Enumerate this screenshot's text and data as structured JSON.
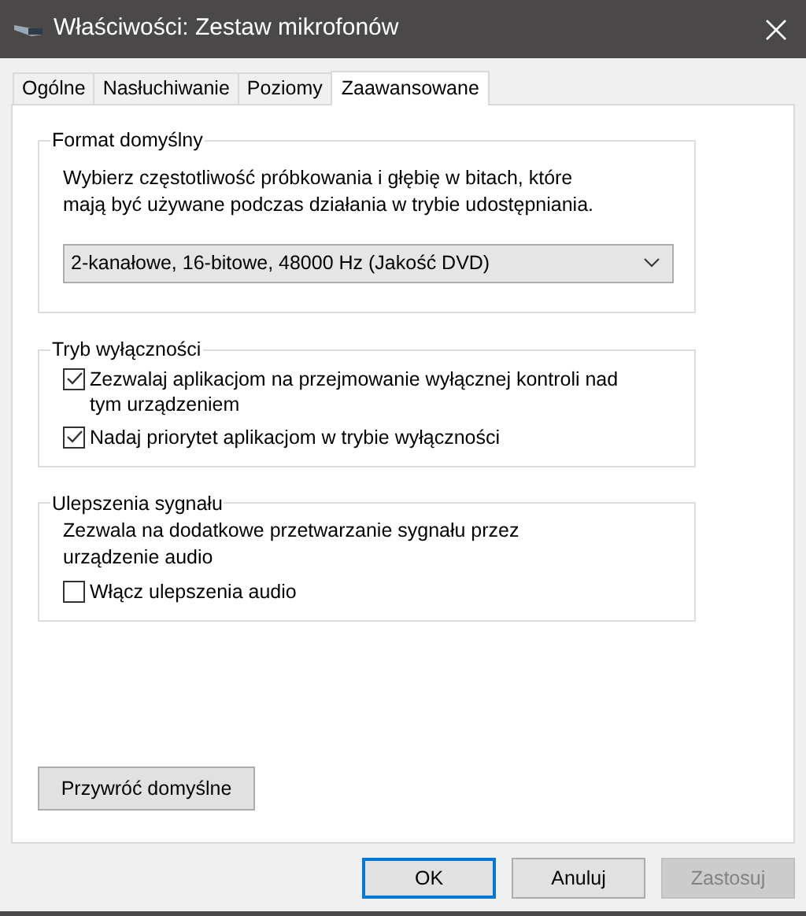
{
  "window": {
    "title": "Właściwości: Zestaw mikrofonów"
  },
  "tabs": [
    {
      "label": "Ogólne",
      "selected": false
    },
    {
      "label": "Nasłuchiwanie",
      "selected": false
    },
    {
      "label": "Poziomy",
      "selected": false
    },
    {
      "label": "Zaawansowane",
      "selected": true
    }
  ],
  "groups": [
    {
      "title": "Format domyślny",
      "items": [
        {
          "kind": "text",
          "text": "Wybierz częstotliwość próbkowania i głębię w bitach, które mają być używane podczas działania w trybie udostępniania."
        },
        {
          "kind": "dropdown",
          "value": "2-kanałowe, 16-bitowe, 48000 Hz (Jakość DVD)"
        }
      ]
    },
    {
      "title": "Tryb wyłączności",
      "items": [
        {
          "kind": "checkbox",
          "label": "Zezwalaj aplikacjom na przejmowanie wyłącznej kontroli nad tym urządzeniem",
          "checked": true
        },
        {
          "kind": "checkbox",
          "label": "Nadaj priorytet aplikacjom w trybie wyłączności",
          "checked": true
        }
      ]
    },
    {
      "title": "Ulepszenia sygnału",
      "items": [
        {
          "kind": "text",
          "text": "Zezwala na dodatkowe przetwarzanie sygnału przez urządzenie audio"
        },
        {
          "kind": "checkbox",
          "label": "Włącz ulepszenia audio",
          "checked": false
        }
      ]
    }
  ],
  "restore_button": "Przywróć domyślne",
  "buttons": [
    {
      "label": "OK",
      "kind": "default",
      "disabled": false
    },
    {
      "label": "Anuluj",
      "kind": "normal",
      "disabled": false
    },
    {
      "label": "Zastosuj",
      "kind": "normal",
      "disabled": true
    }
  ]
}
